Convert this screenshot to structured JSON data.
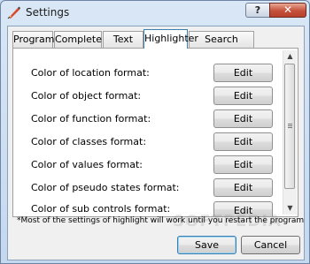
{
  "window": {
    "title": "Settings",
    "help_label": "?",
    "close_label": "✕"
  },
  "tabs": [
    {
      "label": "Program",
      "active": false
    },
    {
      "label": "Completer",
      "active": false
    },
    {
      "label": "Text Edit",
      "active": false
    },
    {
      "label": "Highlighter",
      "active": true
    },
    {
      "label": "Search mistakes",
      "active": false
    }
  ],
  "rows": [
    {
      "label": "Color of location format:",
      "button": "Edit"
    },
    {
      "label": "Color of object format:",
      "button": "Edit"
    },
    {
      "label": "Color of function format:",
      "button": "Edit"
    },
    {
      "label": "Color of classes format:",
      "button": "Edit"
    },
    {
      "label": "Color of values format:",
      "button": "Edit"
    },
    {
      "label": "Color of pseudo states format:",
      "button": "Edit"
    },
    {
      "label": "Color of sub controls format:",
      "button": "Edit"
    }
  ],
  "note": "*Most of the settings of highlight will work until you restart the program",
  "footer": {
    "save_label": "Save",
    "cancel_label": "Cancel"
  },
  "watermark": "SOFTPEDIA",
  "icons": {
    "app": "text-editor-app-icon",
    "scroll_up": "scroll-up-arrow",
    "scroll_down": "scroll-down-arrow"
  }
}
